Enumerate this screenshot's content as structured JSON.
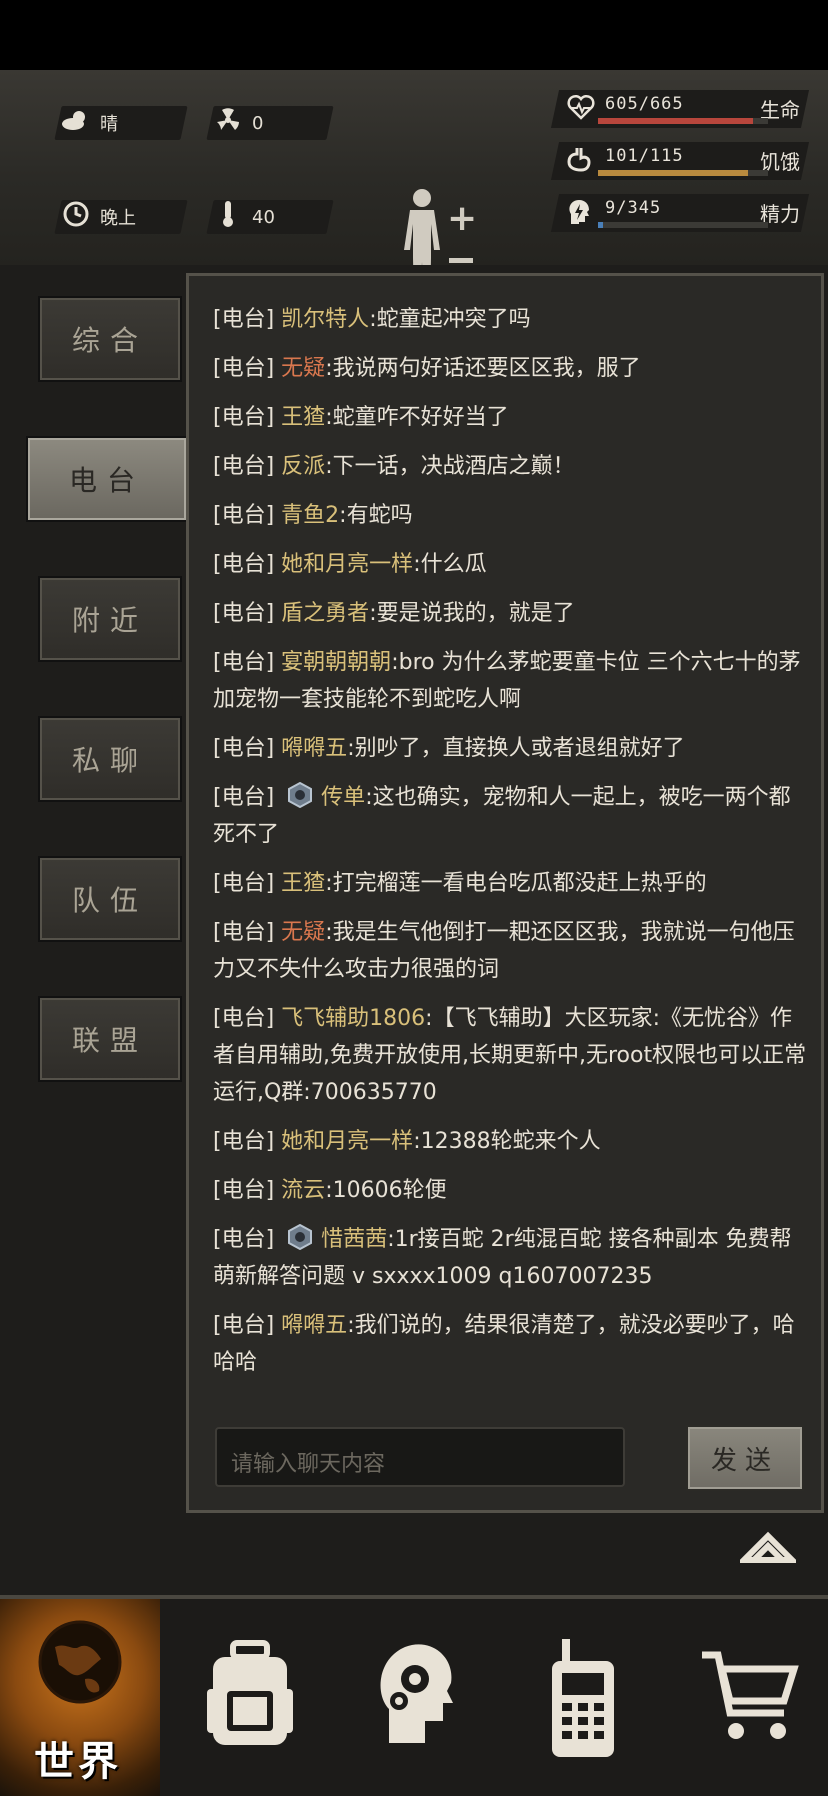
{
  "hud": {
    "weather": "晴",
    "radiation": "0",
    "time_of_day": "晚上",
    "temperature": "40"
  },
  "stats": [
    {
      "value": "605/665",
      "label": "生命",
      "fill": 0.91,
      "color": "#b8463c"
    },
    {
      "value": "101/115",
      "label": "饥饿",
      "fill": 0.88,
      "color": "#b98a3e"
    },
    {
      "value": "9/345",
      "label": "精力",
      "fill": 0.03,
      "color": "#4a7fb8"
    }
  ],
  "sidebar": {
    "items": [
      {
        "label": "综合",
        "active": false
      },
      {
        "label": "电台",
        "active": true
      },
      {
        "label": "附近",
        "active": false
      },
      {
        "label": "私聊",
        "active": false
      },
      {
        "label": "队伍",
        "active": false
      },
      {
        "label": "联盟",
        "active": false
      }
    ]
  },
  "chat": {
    "channel_tag": "[电台]",
    "messages": [
      {
        "name": "凯尔特人",
        "text": ":蛇童起冲突了吗",
        "red": false,
        "avatar": false
      },
      {
        "name": "无疑",
        "text": ":我说两句好话还要区区我，服了",
        "red": true,
        "avatar": false
      },
      {
        "name": "王猹",
        "text": ":蛇童咋不好好当了",
        "red": false,
        "avatar": false
      },
      {
        "name": "反派",
        "text": ":下一话，决战酒店之巅！",
        "red": false,
        "avatar": false
      },
      {
        "name": "青鱼2",
        "text": ":有蛇吗",
        "red": false,
        "avatar": false
      },
      {
        "name": "她和月亮一样",
        "text": ":什么瓜",
        "red": false,
        "avatar": false
      },
      {
        "name": "盾之勇者",
        "text": ":要是说我的，就是了",
        "red": false,
        "avatar": false
      },
      {
        "name": "宴朝朝朝朝",
        "text": ":bro 为什么茅蛇要童卡位 三个六七十的茅加宠物一套技能轮不到蛇吃人啊",
        "red": false,
        "avatar": false
      },
      {
        "name": "嘚嘚五",
        "text": ":别吵了，直接换人或者退组就好了",
        "red": false,
        "avatar": false
      },
      {
        "name": "传单",
        "text": ":这也确实，宠物和人一起上，被吃一两个都死不了",
        "red": false,
        "avatar": true
      },
      {
        "name": "王猹",
        "text": ":打完榴莲一看电台吃瓜都没赶上热乎的",
        "red": false,
        "avatar": false
      },
      {
        "name": "无疑",
        "text": ":我是生气他倒打一耙还区区我，我就说一句他压力又不失什么攻击力很强的词",
        "red": true,
        "avatar": false
      },
      {
        "name": "飞飞辅助1806",
        "text": ":【飞飞辅助】大区玩家:《无忧谷》作者自用辅助,免费开放使用,长期更新中,无root权限也可以正常运行,Q群:700635770",
        "red": false,
        "avatar": false
      },
      {
        "name": "她和月亮一样",
        "text": ":12388轮蛇来个人",
        "red": false,
        "avatar": false
      },
      {
        "name": "流云",
        "text": ":10606轮便",
        "red": false,
        "avatar": false
      },
      {
        "name": "惜茜茜",
        "text": ":1r接百蛇 2r纯混百蛇 接各种副本 免费帮萌新解答问题 v sxxxx1009 q1607007235",
        "red": false,
        "avatar": true
      },
      {
        "name": "嘚嘚五",
        "text": ":我们说的，结果很清楚了，就没必要吵了，哈哈哈",
        "red": false,
        "avatar": false
      }
    ],
    "input_placeholder": "请输入聊天内容",
    "send_label": "发送"
  },
  "bottom_nav": {
    "world_label": "世界",
    "icons": [
      "backpack-icon",
      "head-gear-icon",
      "radio-icon",
      "cart-icon"
    ]
  }
}
